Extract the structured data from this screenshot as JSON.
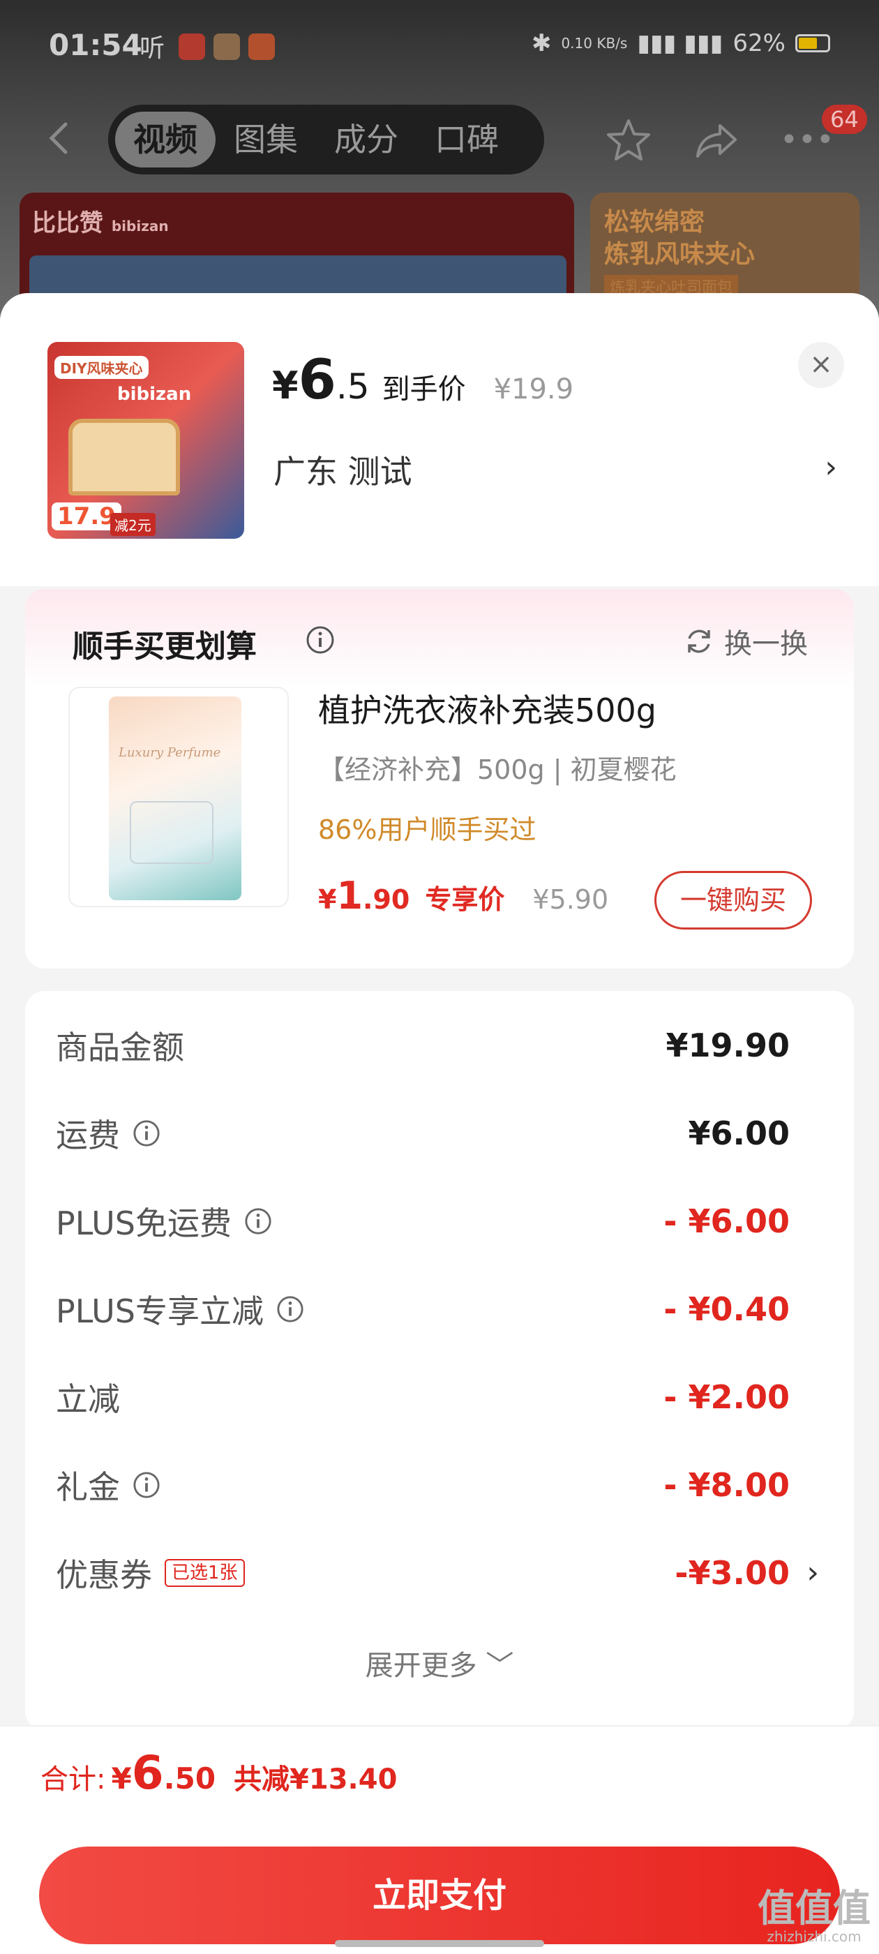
{
  "status_bar": {
    "time": "01:54",
    "listen": "听",
    "net_speed": "0.10 KB/s",
    "battery": "62%"
  },
  "nav": {
    "tabs": [
      "视频",
      "图集",
      "成分",
      "口碑"
    ],
    "badge": "64"
  },
  "banner": {
    "brand": "比比赞",
    "brand_en": "bibizan",
    "right_title_1": "松软绵密",
    "right_title_2": "炼乳风味夹心",
    "right_sub": "炼乳夹心吐司面包"
  },
  "sheet": {
    "product_img": {
      "tag": "DIY风味夹心",
      "brand": "bibizan",
      "price": "17.9",
      "promo": "减2元"
    },
    "price": {
      "currency": "¥",
      "integer": "6",
      "decimal": ".5",
      "label": "到手价",
      "original": "¥19.9"
    },
    "address": "广东  测试",
    "chevron": "›",
    "close": "×"
  },
  "addon": {
    "title": "顺手买更划算",
    "swap_label": "换一换",
    "name": "植护洗衣液补充装500g",
    "spec": "【经济补充】500g | 初夏樱花",
    "bought": "86%用户顺手买过",
    "price_currency": "¥",
    "price_int": "1",
    "price_dec": ".90",
    "price_label": "专享价",
    "price_orig": "¥5.90",
    "buy_label": "一键购买",
    "img_text": "Luxury Perfume"
  },
  "breakdown": {
    "rows": [
      {
        "label": "商品金额",
        "value": "¥19.90",
        "info": false
      },
      {
        "label": "运费",
        "value": "¥6.00",
        "info": true
      },
      {
        "label": "PLUS免运费",
        "value": "- ¥6.00",
        "info": true
      },
      {
        "label": "PLUS专享立减",
        "value": "- ¥0.40",
        "info": true
      },
      {
        "label": "立减",
        "value": "- ¥2.00",
        "info": false
      },
      {
        "label": "礼金",
        "value": "- ¥8.00",
        "info": true
      },
      {
        "label": "优惠券",
        "value": "-¥3.00",
        "chip": "已选1张"
      }
    ],
    "expand_label": "展开更多 ﹀"
  },
  "footer": {
    "total_label": "合计:",
    "total_currency": "¥",
    "total_int": "6",
    "total_dec": ".50",
    "saved": "共减¥13.40",
    "pay_label": "立即支付"
  },
  "watermark": {
    "main": "值值值",
    "sub": "zhizhizhi.com"
  },
  "colors": {
    "accent_red": "#e0261e",
    "bought_orange": "#d08a2a",
    "pay_gradient_start": "#f24a44"
  }
}
